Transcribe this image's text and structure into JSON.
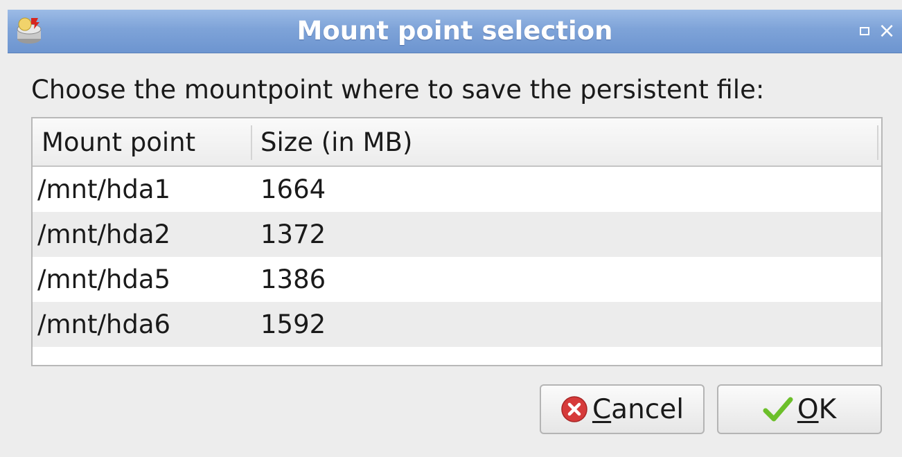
{
  "window": {
    "title": "Mount point selection",
    "icon": "drive-icon",
    "controls": {
      "maximize_icon": "maximize-icon",
      "close_icon": "close-icon",
      "close_glyph": "×"
    }
  },
  "prompt": "Choose the mountpoint where to save the persistent file:",
  "table": {
    "columns": [
      "Mount point",
      "Size (in MB)"
    ],
    "rows": [
      {
        "mount": "/mnt/hda1",
        "size": "1664"
      },
      {
        "mount": "/mnt/hda2",
        "size": "1372"
      },
      {
        "mount": "/mnt/hda5",
        "size": "1386"
      },
      {
        "mount": "/mnt/hda6",
        "size": "1592"
      }
    ]
  },
  "buttons": {
    "cancel": {
      "mnemonic": "C",
      "rest": "ancel",
      "icon": "cancel-icon"
    },
    "ok": {
      "mnemonic": "O",
      "rest": "K",
      "icon": "check-icon"
    }
  },
  "colors": {
    "titlebar": "#7ea3d8",
    "cancel_icon": "#d63a3a",
    "check_icon": "#6cbf2a"
  }
}
